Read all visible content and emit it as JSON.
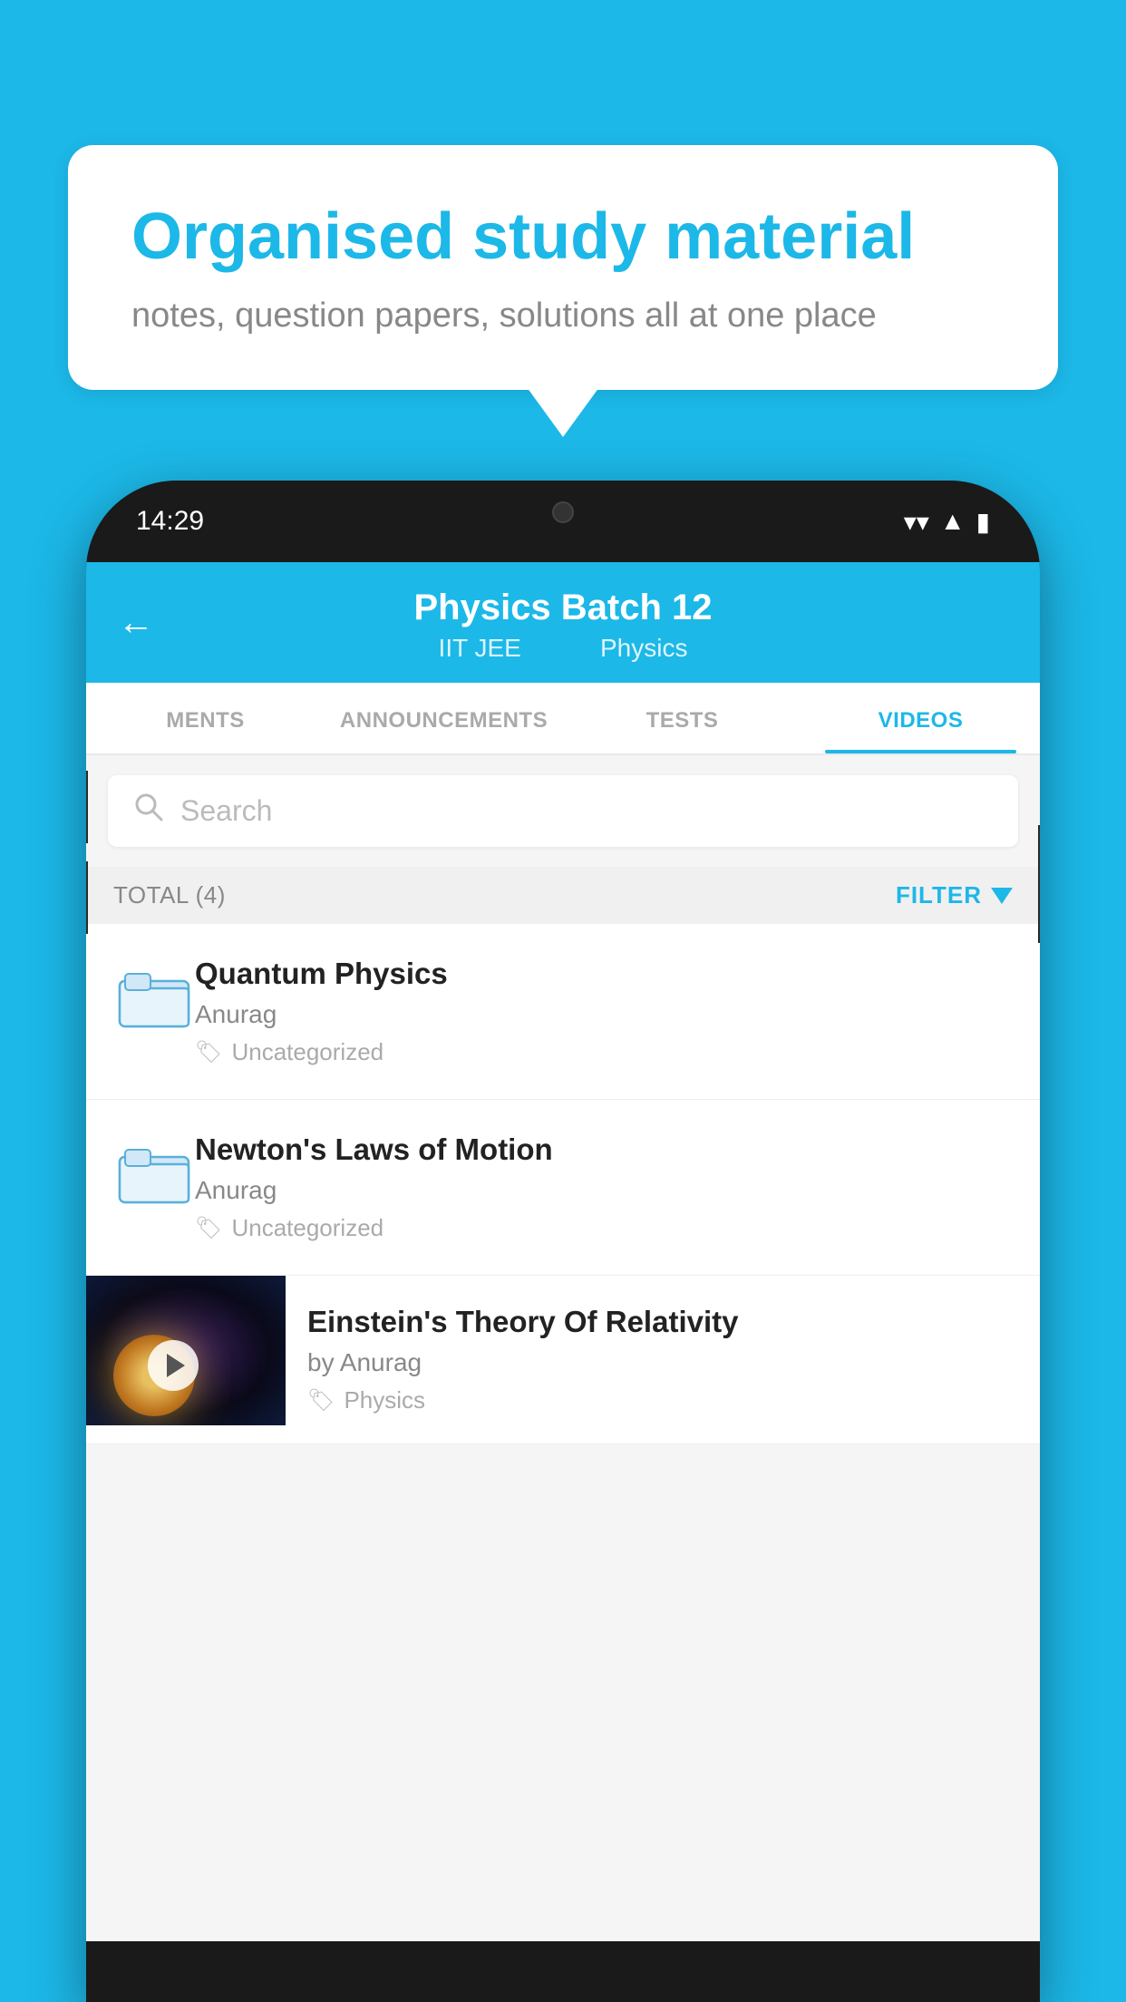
{
  "background_color": "#1cb8e8",
  "bubble": {
    "title": "Organised study material",
    "subtitle": "notes, question papers, solutions all at one place"
  },
  "phone": {
    "time": "14:29",
    "header": {
      "title": "Physics Batch 12",
      "subtitle_left": "IIT JEE",
      "subtitle_right": "Physics",
      "back_label": "←"
    },
    "tabs": [
      {
        "label": "MENTS",
        "active": false
      },
      {
        "label": "ANNOUNCEMENTS",
        "active": false
      },
      {
        "label": "TESTS",
        "active": false
      },
      {
        "label": "VIDEOS",
        "active": true
      }
    ],
    "search": {
      "placeholder": "Search"
    },
    "filter_bar": {
      "total_label": "TOTAL (4)",
      "filter_label": "FILTER"
    },
    "videos": [
      {
        "id": 1,
        "title": "Quantum Physics",
        "author": "Anurag",
        "tag": "Uncategorized",
        "type": "folder"
      },
      {
        "id": 2,
        "title": "Newton's Laws of Motion",
        "author": "Anurag",
        "tag": "Uncategorized",
        "type": "folder"
      },
      {
        "id": 3,
        "title": "Einstein's Theory Of Relativity",
        "author": "by Anurag",
        "tag": "Physics",
        "type": "video"
      }
    ]
  }
}
